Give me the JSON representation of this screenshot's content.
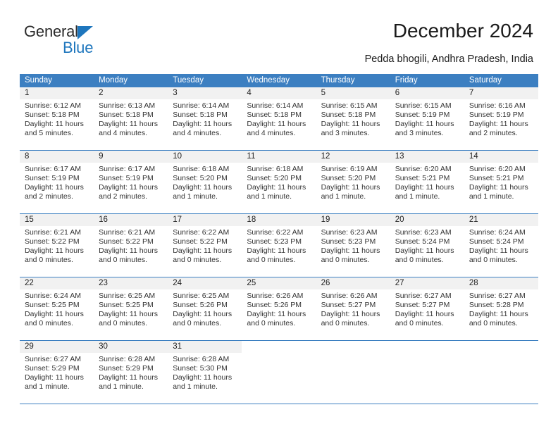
{
  "brand": {
    "name_top": "General",
    "name_bottom": "Blue",
    "accent_color": "#1e76bd"
  },
  "header": {
    "title": "December 2024",
    "subtitle": "Pedda bhogili, Andhra Pradesh, India"
  },
  "calendar": {
    "header_bg": "#3c7fc1",
    "day_band_bg": "#f1f1f1",
    "weekdays": [
      "Sunday",
      "Monday",
      "Tuesday",
      "Wednesday",
      "Thursday",
      "Friday",
      "Saturday"
    ],
    "weeks": [
      [
        {
          "day": "1",
          "sunrise": "Sunrise: 6:12 AM",
          "sunset": "Sunset: 5:18 PM",
          "daylight1": "Daylight: 11 hours",
          "daylight2": "and 5 minutes."
        },
        {
          "day": "2",
          "sunrise": "Sunrise: 6:13 AM",
          "sunset": "Sunset: 5:18 PM",
          "daylight1": "Daylight: 11 hours",
          "daylight2": "and 4 minutes."
        },
        {
          "day": "3",
          "sunrise": "Sunrise: 6:14 AM",
          "sunset": "Sunset: 5:18 PM",
          "daylight1": "Daylight: 11 hours",
          "daylight2": "and 4 minutes."
        },
        {
          "day": "4",
          "sunrise": "Sunrise: 6:14 AM",
          "sunset": "Sunset: 5:18 PM",
          "daylight1": "Daylight: 11 hours",
          "daylight2": "and 4 minutes."
        },
        {
          "day": "5",
          "sunrise": "Sunrise: 6:15 AM",
          "sunset": "Sunset: 5:18 PM",
          "daylight1": "Daylight: 11 hours",
          "daylight2": "and 3 minutes."
        },
        {
          "day": "6",
          "sunrise": "Sunrise: 6:15 AM",
          "sunset": "Sunset: 5:19 PM",
          "daylight1": "Daylight: 11 hours",
          "daylight2": "and 3 minutes."
        },
        {
          "day": "7",
          "sunrise": "Sunrise: 6:16 AM",
          "sunset": "Sunset: 5:19 PM",
          "daylight1": "Daylight: 11 hours",
          "daylight2": "and 2 minutes."
        }
      ],
      [
        {
          "day": "8",
          "sunrise": "Sunrise: 6:17 AM",
          "sunset": "Sunset: 5:19 PM",
          "daylight1": "Daylight: 11 hours",
          "daylight2": "and 2 minutes."
        },
        {
          "day": "9",
          "sunrise": "Sunrise: 6:17 AM",
          "sunset": "Sunset: 5:19 PM",
          "daylight1": "Daylight: 11 hours",
          "daylight2": "and 2 minutes."
        },
        {
          "day": "10",
          "sunrise": "Sunrise: 6:18 AM",
          "sunset": "Sunset: 5:20 PM",
          "daylight1": "Daylight: 11 hours",
          "daylight2": "and 1 minute."
        },
        {
          "day": "11",
          "sunrise": "Sunrise: 6:18 AM",
          "sunset": "Sunset: 5:20 PM",
          "daylight1": "Daylight: 11 hours",
          "daylight2": "and 1 minute."
        },
        {
          "day": "12",
          "sunrise": "Sunrise: 6:19 AM",
          "sunset": "Sunset: 5:20 PM",
          "daylight1": "Daylight: 11 hours",
          "daylight2": "and 1 minute."
        },
        {
          "day": "13",
          "sunrise": "Sunrise: 6:20 AM",
          "sunset": "Sunset: 5:21 PM",
          "daylight1": "Daylight: 11 hours",
          "daylight2": "and 1 minute."
        },
        {
          "day": "14",
          "sunrise": "Sunrise: 6:20 AM",
          "sunset": "Sunset: 5:21 PM",
          "daylight1": "Daylight: 11 hours",
          "daylight2": "and 1 minute."
        }
      ],
      [
        {
          "day": "15",
          "sunrise": "Sunrise: 6:21 AM",
          "sunset": "Sunset: 5:22 PM",
          "daylight1": "Daylight: 11 hours",
          "daylight2": "and 0 minutes."
        },
        {
          "day": "16",
          "sunrise": "Sunrise: 6:21 AM",
          "sunset": "Sunset: 5:22 PM",
          "daylight1": "Daylight: 11 hours",
          "daylight2": "and 0 minutes."
        },
        {
          "day": "17",
          "sunrise": "Sunrise: 6:22 AM",
          "sunset": "Sunset: 5:22 PM",
          "daylight1": "Daylight: 11 hours",
          "daylight2": "and 0 minutes."
        },
        {
          "day": "18",
          "sunrise": "Sunrise: 6:22 AM",
          "sunset": "Sunset: 5:23 PM",
          "daylight1": "Daylight: 11 hours",
          "daylight2": "and 0 minutes."
        },
        {
          "day": "19",
          "sunrise": "Sunrise: 6:23 AM",
          "sunset": "Sunset: 5:23 PM",
          "daylight1": "Daylight: 11 hours",
          "daylight2": "and 0 minutes."
        },
        {
          "day": "20",
          "sunrise": "Sunrise: 6:23 AM",
          "sunset": "Sunset: 5:24 PM",
          "daylight1": "Daylight: 11 hours",
          "daylight2": "and 0 minutes."
        },
        {
          "day": "21",
          "sunrise": "Sunrise: 6:24 AM",
          "sunset": "Sunset: 5:24 PM",
          "daylight1": "Daylight: 11 hours",
          "daylight2": "and 0 minutes."
        }
      ],
      [
        {
          "day": "22",
          "sunrise": "Sunrise: 6:24 AM",
          "sunset": "Sunset: 5:25 PM",
          "daylight1": "Daylight: 11 hours",
          "daylight2": "and 0 minutes."
        },
        {
          "day": "23",
          "sunrise": "Sunrise: 6:25 AM",
          "sunset": "Sunset: 5:25 PM",
          "daylight1": "Daylight: 11 hours",
          "daylight2": "and 0 minutes."
        },
        {
          "day": "24",
          "sunrise": "Sunrise: 6:25 AM",
          "sunset": "Sunset: 5:26 PM",
          "daylight1": "Daylight: 11 hours",
          "daylight2": "and 0 minutes."
        },
        {
          "day": "25",
          "sunrise": "Sunrise: 6:26 AM",
          "sunset": "Sunset: 5:26 PM",
          "daylight1": "Daylight: 11 hours",
          "daylight2": "and 0 minutes."
        },
        {
          "day": "26",
          "sunrise": "Sunrise: 6:26 AM",
          "sunset": "Sunset: 5:27 PM",
          "daylight1": "Daylight: 11 hours",
          "daylight2": "and 0 minutes."
        },
        {
          "day": "27",
          "sunrise": "Sunrise: 6:27 AM",
          "sunset": "Sunset: 5:27 PM",
          "daylight1": "Daylight: 11 hours",
          "daylight2": "and 0 minutes."
        },
        {
          "day": "28",
          "sunrise": "Sunrise: 6:27 AM",
          "sunset": "Sunset: 5:28 PM",
          "daylight1": "Daylight: 11 hours",
          "daylight2": "and 0 minutes."
        }
      ],
      [
        {
          "day": "29",
          "sunrise": "Sunrise: 6:27 AM",
          "sunset": "Sunset: 5:29 PM",
          "daylight1": "Daylight: 11 hours",
          "daylight2": "and 1 minute."
        },
        {
          "day": "30",
          "sunrise": "Sunrise: 6:28 AM",
          "sunset": "Sunset: 5:29 PM",
          "daylight1": "Daylight: 11 hours",
          "daylight2": "and 1 minute."
        },
        {
          "day": "31",
          "sunrise": "Sunrise: 6:28 AM",
          "sunset": "Sunset: 5:30 PM",
          "daylight1": "Daylight: 11 hours",
          "daylight2": "and 1 minute."
        },
        {
          "day": "",
          "sunrise": "",
          "sunset": "",
          "daylight1": "",
          "daylight2": ""
        },
        {
          "day": "",
          "sunrise": "",
          "sunset": "",
          "daylight1": "",
          "daylight2": ""
        },
        {
          "day": "",
          "sunrise": "",
          "sunset": "",
          "daylight1": "",
          "daylight2": ""
        },
        {
          "day": "",
          "sunrise": "",
          "sunset": "",
          "daylight1": "",
          "daylight2": ""
        }
      ]
    ]
  }
}
